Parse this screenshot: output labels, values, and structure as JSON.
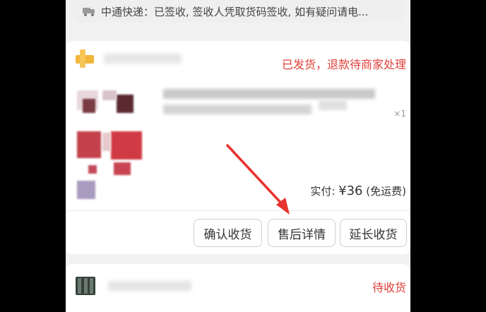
{
  "logistics": {
    "text": "中通快递：已签收, 签收人凭取货码签收, 如有疑问请电..."
  },
  "order1": {
    "status": "已发货，退款待商家处理",
    "quantity": "×1",
    "paid_label": "实付: ",
    "paid_amount": "¥36",
    "shipping_note": " (免运费)",
    "buttons": {
      "confirm": "确认收货",
      "after_sale": "售后详情",
      "extend": "延长收货"
    }
  },
  "order2": {
    "status": "待收货"
  },
  "colors": {
    "status_red": "#e0403a",
    "arrow_red": "#e8322d",
    "shop_icon": "#f3b53b"
  },
  "icons": {
    "logistics": "truck-icon",
    "shop": "store-icon"
  }
}
